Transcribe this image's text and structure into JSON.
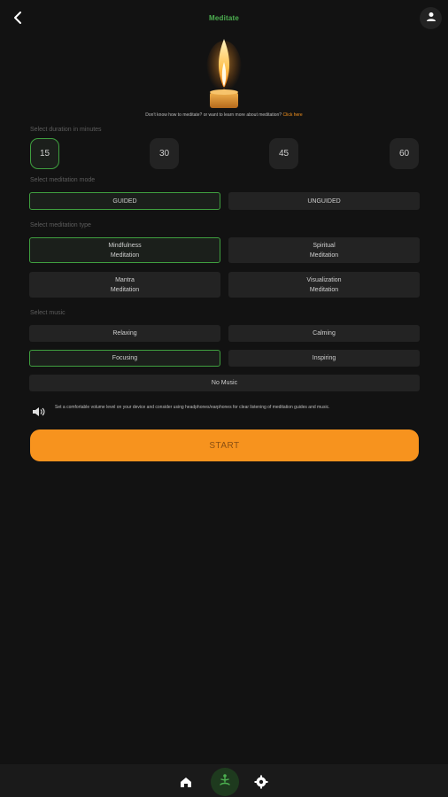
{
  "header": {
    "title": "Meditate"
  },
  "intro": {
    "learn_text": "Don't know how to meditate? or want to learn more about meditation?",
    "learn_link": "Click here"
  },
  "duration": {
    "label": "Select duration in minutes",
    "options": [
      "15",
      "30",
      "45",
      "60"
    ],
    "selected": "15"
  },
  "mode": {
    "label": "Select meditation mode",
    "options": [
      "GUIDED",
      "UNGUIDED"
    ],
    "selected": "GUIDED"
  },
  "type": {
    "label": "Select meditation type",
    "options": [
      {
        "line1": "Mindfulness",
        "line2": "Meditation"
      },
      {
        "line1": "Spiritual",
        "line2": "Meditation"
      },
      {
        "line1": "Mantra",
        "line2": "Meditation"
      },
      {
        "line1": "Visualization",
        "line2": "Meditation"
      }
    ],
    "selected": "Mindfulness"
  },
  "music": {
    "label": "Select music",
    "options": [
      "Relaxing",
      "Calming",
      "Focusing",
      "Inspiring",
      "No Music"
    ],
    "selected": "Focusing"
  },
  "note": {
    "icon": "speaker-icon",
    "text": "Set a comfortable volume level on your device and consider using headphones/earphones for clear listening of meditation guides and music."
  },
  "start_label": "START",
  "bottom_nav": {
    "items": [
      "home-icon",
      "meditation-icon",
      "settings-icon"
    ],
    "active": "meditation-icon"
  },
  "colors": {
    "background": "#121212",
    "accent_green": "#4caf50",
    "accent_orange": "#f7931e",
    "card": "#232323"
  }
}
